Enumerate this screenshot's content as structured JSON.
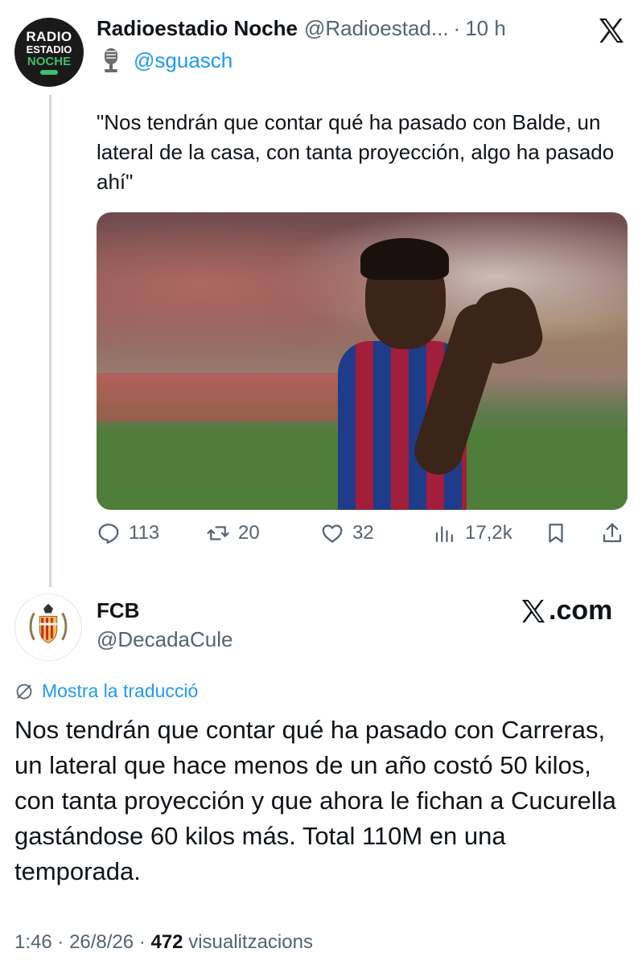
{
  "parent_tweet": {
    "avatar": {
      "line1": "RADIO",
      "line2": "ESTADIO",
      "line3": "NOCHE"
    },
    "author_name": "Radioestadio Noche",
    "author_handle": "@Radioestad...",
    "separator": "·",
    "time": "10 h",
    "mention": "@sguasch",
    "text": "\"Nos tendrán que contar qué ha pasado con Balde, un lateral de la casa, con tanta proyección, algo ha pasado ahí\"",
    "stats": {
      "replies": "113",
      "reposts": "20",
      "likes": "32",
      "views": "17,2k"
    }
  },
  "main_tweet": {
    "author_name": "FCB",
    "author_handle": "@DecadaCule",
    "watermark": "X.com",
    "translate_label": "Mostra la traducció",
    "text": "Nos tendrán que contar qué ha pasado con Carreras, un lateral que hace menos de un año costó 50 kilos, con tanta proyección y que ahora le fichan a Cucurella gastándose 60 kilos más. Total 110M en una temporada.",
    "time": "1:46",
    "date": "26/8/26",
    "views_count": "472",
    "views_label": "visualitzacions"
  },
  "colors": {
    "accent": "#1d9bf0",
    "secondary": "#536471",
    "text": "#0f1419"
  },
  "icons": [
    "x-logo-icon",
    "microphone-icon",
    "reply-icon",
    "repost-icon",
    "like-icon",
    "views-icon",
    "bookmark-icon",
    "share-icon",
    "translate-icon"
  ]
}
